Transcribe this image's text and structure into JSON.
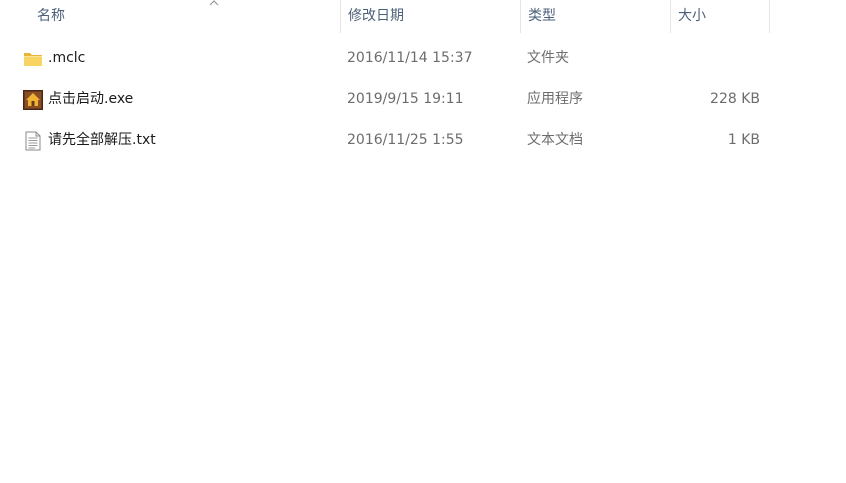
{
  "columns": {
    "name": "名称",
    "date": "修改日期",
    "type": "类型",
    "size": "大小"
  },
  "sort_indicator_icon": "chevron-up-icon",
  "files": [
    {
      "name": ".mclc",
      "date": "2016/11/14 15:37",
      "type": "文件夹",
      "size": "",
      "icon": "folder-icon"
    },
    {
      "name": "点击启动.exe",
      "date": "2019/9/15 19:11",
      "type": "应用程序",
      "size": "228 KB",
      "icon": "app-house-icon"
    },
    {
      "name": "请先全部解压.txt",
      "date": "2016/11/25 1:55",
      "type": "文本文档",
      "size": "1 KB",
      "icon": "text-file-icon"
    }
  ],
  "colors": {
    "header_text": "#4c607a",
    "name_text": "#1a1a1a",
    "detail_text": "#6d6d6d",
    "folder_yellow": "#f5c94a"
  }
}
